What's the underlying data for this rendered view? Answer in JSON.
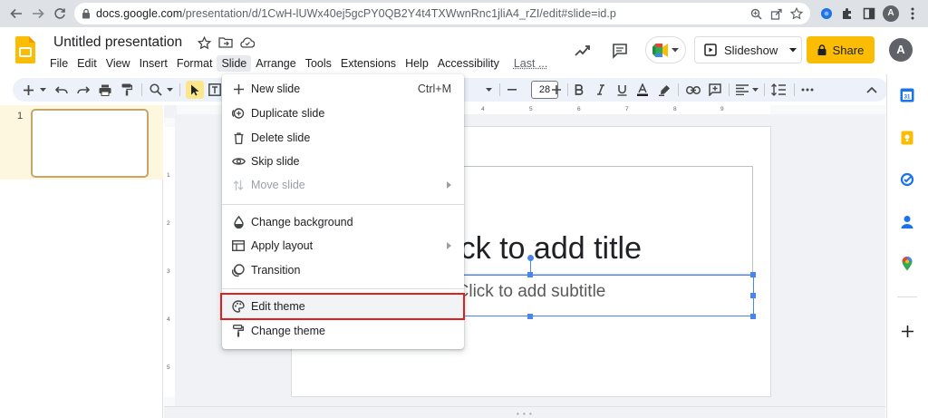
{
  "browser": {
    "url_host": "docs.google.com",
    "url_path": "/presentation/d/1CwH-lUWx40ej5gcPY0QB2Y4t4TXWwnRnc1jliA4_rZI/edit#slide=id.p",
    "profile_initial": "A"
  },
  "header": {
    "title": "Untitled presentation",
    "slideshow_label": "Slideshow",
    "share_label": "Share",
    "profile_initial": "A"
  },
  "menubar": {
    "items": [
      "File",
      "Edit",
      "View",
      "Insert",
      "Format",
      "Slide",
      "Arrange",
      "Tools",
      "Extensions",
      "Help",
      "Accessibility",
      "Last ..."
    ],
    "active": "Slide"
  },
  "toolbar": {
    "font_size": "28"
  },
  "filmstrip": {
    "slide_number": "1"
  },
  "slide": {
    "title_placeholder": "Click to add title",
    "subtitle_placeholder": "Click to add subtitle",
    "ruler_top_numbers": [
      "4",
      "5",
      "6",
      "7",
      "8",
      "9"
    ],
    "ruler_left_numbers": [
      "1",
      "2",
      "3",
      "4",
      "5"
    ]
  },
  "slide_menu": {
    "items": [
      {
        "label": "New slide",
        "shortcut": "Ctrl+M",
        "icon": "plus-icon"
      },
      {
        "label": "Duplicate slide",
        "icon": "duplicate-icon"
      },
      {
        "label": "Delete slide",
        "icon": "trash-icon"
      },
      {
        "label": "Skip slide",
        "icon": "eye-icon"
      },
      {
        "label": "Move slide",
        "icon": "move-icon",
        "disabled": true,
        "submenu": true
      },
      {
        "label": "Change background",
        "icon": "droplet-icon"
      },
      {
        "label": "Apply layout",
        "icon": "layout-icon",
        "submenu": true
      },
      {
        "label": "Transition",
        "icon": "transition-icon"
      },
      {
        "label": "Edit theme",
        "icon": "palette-icon",
        "highlighted": true
      },
      {
        "label": "Change theme",
        "icon": "paint-roller-icon"
      }
    ]
  },
  "colors": {
    "accent_yellow": "#fbbc04",
    "selection_blue": "#4a86e8",
    "highlight_red": "#e02020"
  }
}
